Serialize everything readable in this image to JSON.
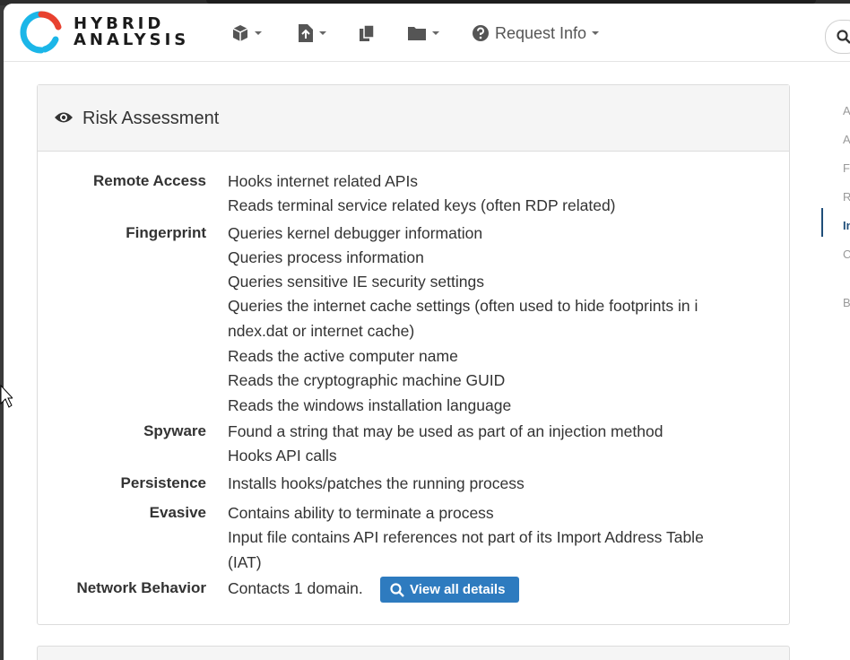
{
  "app": {
    "logo_line1": "HYBRID",
    "logo_line2": "ANALYSIS"
  },
  "navbar": {
    "request_info_label": "Request Info",
    "icons": [
      "cube-icon",
      "file-upload-icon",
      "copy-icon",
      "folder-icon",
      "question-circle-icon",
      "search-icon"
    ]
  },
  "risk_assessment": {
    "title": "Risk Assessment",
    "categories": [
      {
        "name": "Remote Access",
        "lines": [
          "Hooks internet related APIs",
          "Reads terminal service related keys (often RDP related)"
        ]
      },
      {
        "name": "Fingerprint",
        "lines": [
          "Queries kernel debugger information",
          "Queries process information",
          "Queries sensitive IE security settings",
          "Queries the internet cache settings (often used to hide footprints in i",
          "ndex.dat or internet cache)",
          "Reads the active computer name",
          "Reads the cryptographic machine GUID",
          "Reads the windows installation language"
        ]
      },
      {
        "name": "Spyware",
        "lines": [
          "Found a string that may be used as part of an injection method",
          "Hooks API calls"
        ]
      },
      {
        "name": "Persistence",
        "lines": [
          "Installs hooks/patches the running process"
        ]
      },
      {
        "name": "Evasive",
        "lines": [
          "Contains ability to terminate a process",
          "Input file contains API references not part of its Import Address Table",
          "(IAT)"
        ]
      },
      {
        "name": "Network Behavior",
        "lines": [
          "Contacts 1 domain."
        ]
      }
    ],
    "view_all_label": "View all details"
  },
  "sidenav": {
    "items": [
      "A",
      "A",
      "F",
      "R",
      "In",
      "C",
      "B"
    ]
  },
  "colors": {
    "accent": "#2e7bbf",
    "logo_cyan": "#1bb6e8",
    "logo_red": "#e8412f"
  }
}
